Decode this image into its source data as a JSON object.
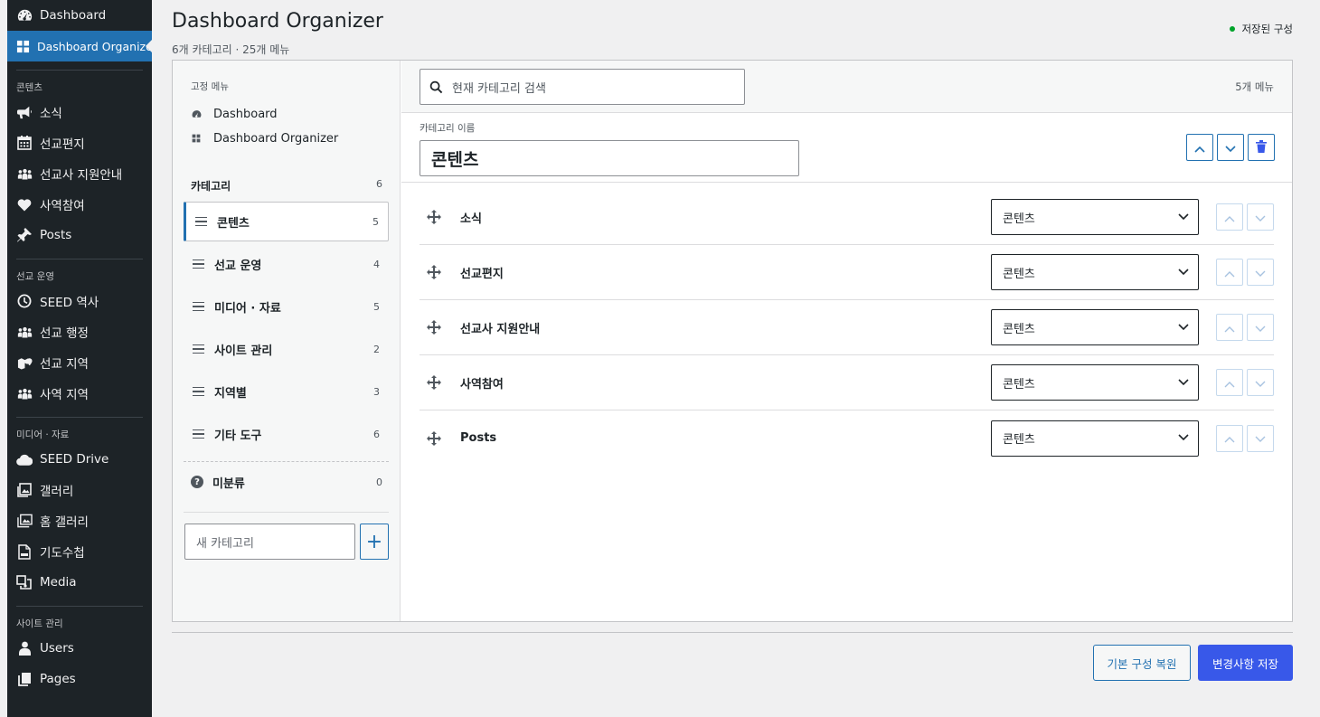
{
  "sidebar": {
    "top": [
      {
        "label": "Dashboard",
        "icon": "dashboard-icon"
      },
      {
        "label": "Dashboard Organizer",
        "icon": "grid-icon"
      }
    ],
    "groups": [
      {
        "title": "콘텐츠",
        "items": [
          {
            "label": "소식",
            "icon": "megaphone-icon"
          },
          {
            "label": "선교편지",
            "icon": "calendar-icon"
          },
          {
            "label": "선교사 지원안내",
            "icon": "groups-icon"
          },
          {
            "label": "사역참여",
            "icon": "heart-icon"
          },
          {
            "label": "Posts",
            "icon": "pin-icon"
          }
        ]
      },
      {
        "title": "선교 운영",
        "items": [
          {
            "label": "SEED 역사",
            "icon": "clock-icon"
          },
          {
            "label": "선교 행정",
            "icon": "groups-icon"
          },
          {
            "label": "선교 지역",
            "icon": "location-icon"
          },
          {
            "label": "사역 지역",
            "icon": "groups-icon"
          }
        ]
      },
      {
        "title": "미디어 · 자료",
        "items": [
          {
            "label": "SEED Drive",
            "icon": "cloud-icon"
          },
          {
            "label": "갤러리",
            "icon": "gallery-icon"
          },
          {
            "label": "홈 갤러리",
            "icon": "images-icon"
          },
          {
            "label": "기도수첩",
            "icon": "pdf-icon"
          },
          {
            "label": "Media",
            "icon": "media-icon"
          }
        ]
      },
      {
        "title": "사이트 관리",
        "items": [
          {
            "label": "Users",
            "icon": "user-icon"
          },
          {
            "label": "Pages",
            "icon": "pages-icon"
          }
        ]
      }
    ]
  },
  "header": {
    "title": "Dashboard Organizer",
    "subtitle": "6개 카테고리 · 25개 메뉴",
    "status": "저장된 구성",
    "status_color": "#00a32a"
  },
  "left_panel": {
    "fixed_title": "고정 메뉴",
    "fixed_items": [
      "Dashboard",
      "Dashboard Organizer"
    ],
    "categories_label": "카테고리",
    "categories_count": "6",
    "categories": [
      {
        "name": "콘텐츠",
        "count": "5"
      },
      {
        "name": "선교 운영",
        "count": "4"
      },
      {
        "name": "미디어 · 자료",
        "count": "5"
      },
      {
        "name": "사이트 관리",
        "count": "2"
      },
      {
        "name": "지역별",
        "count": "3"
      },
      {
        "name": "기타 도구",
        "count": "6"
      }
    ],
    "uncategorized": {
      "name": "미분류",
      "count": "0"
    },
    "new_category_placeholder": "새 카테고리",
    "add_label": "+"
  },
  "right_panel": {
    "search_placeholder": "현재 카테고리 검색",
    "menu_count": "5개 메뉴",
    "category_name_label": "카테고리 이름",
    "category_name": "콘텐츠",
    "items": [
      {
        "name": "소식",
        "category": "콘텐츠"
      },
      {
        "name": "선교편지",
        "category": "콘텐츠"
      },
      {
        "name": "선교사 지원안내",
        "category": "콘텐츠"
      },
      {
        "name": "사역참여",
        "category": "콘텐츠"
      },
      {
        "name": "Posts",
        "category": "콘텐츠"
      }
    ]
  },
  "footer": {
    "reset_label": "기본 구성 복원",
    "save_label": "변경사항 저장"
  },
  "colors": {
    "accent": "#2271b1",
    "save": "#3858e9",
    "sidebar_bg": "#1d2327"
  }
}
